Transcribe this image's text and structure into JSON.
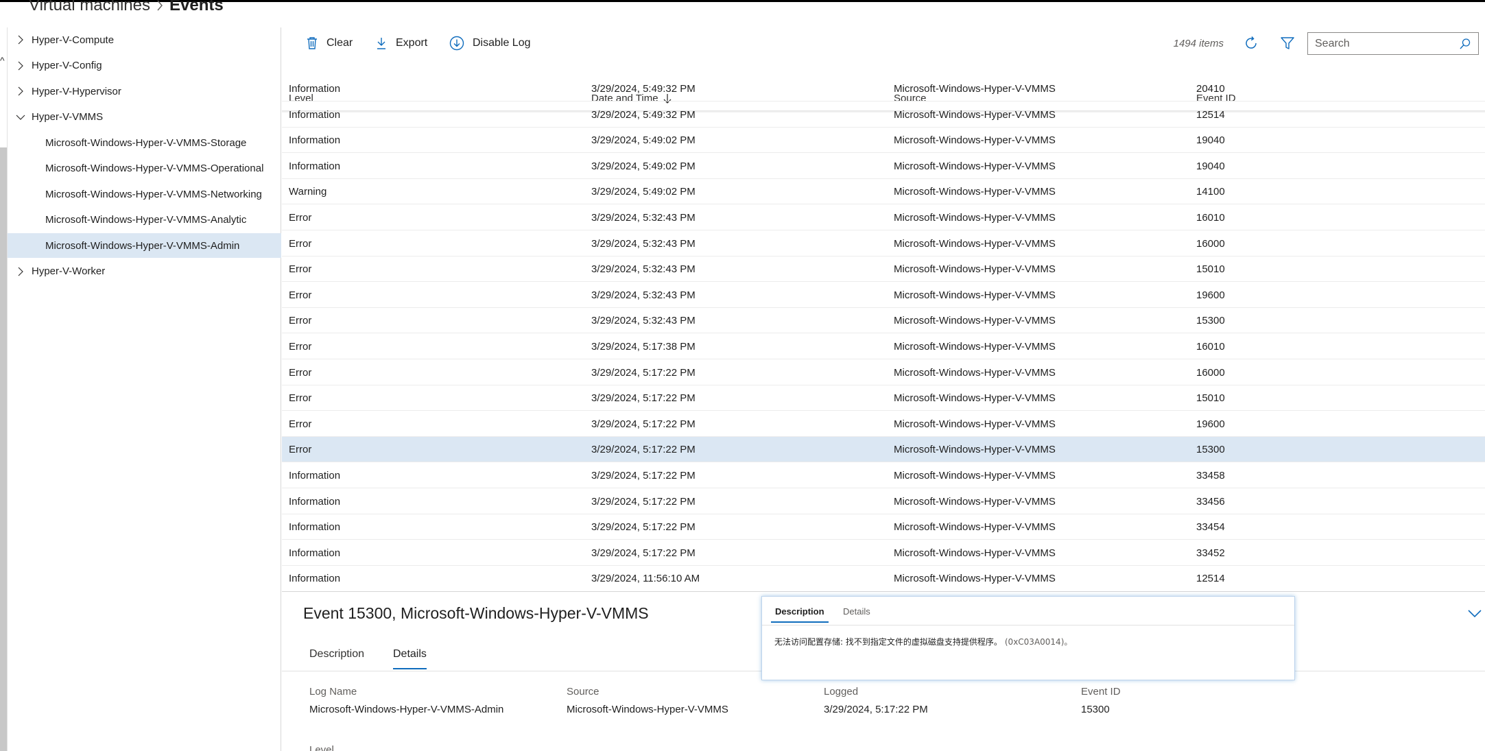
{
  "breadcrumb": {
    "parent": "Virtual machines",
    "current": "Events"
  },
  "sidebar": {
    "items": [
      {
        "label": "Hyper-V-Compute",
        "level": 0,
        "expanded": false
      },
      {
        "label": "Hyper-V-Config",
        "level": 0,
        "expanded": false
      },
      {
        "label": "Hyper-V-Hypervisor",
        "level": 0,
        "expanded": false
      },
      {
        "label": "Hyper-V-VMMS",
        "level": 0,
        "expanded": true
      },
      {
        "label": "Microsoft-Windows-Hyper-V-VMMS-Storage",
        "level": 1
      },
      {
        "label": "Microsoft-Windows-Hyper-V-VMMS-Operational",
        "level": 1
      },
      {
        "label": "Microsoft-Windows-Hyper-V-VMMS-Networking",
        "level": 1
      },
      {
        "label": "Microsoft-Windows-Hyper-V-VMMS-Analytic",
        "level": 1
      },
      {
        "label": "Microsoft-Windows-Hyper-V-VMMS-Admin",
        "level": 1,
        "selected": true
      },
      {
        "label": "Hyper-V-Worker",
        "level": 0,
        "expanded": false
      }
    ]
  },
  "toolbar": {
    "clear_label": "Clear",
    "export_label": "Export",
    "disable_log_label": "Disable Log",
    "item_count": "1494 items",
    "search_placeholder": "Search",
    "accent_color": "#0f6cbd"
  },
  "grid": {
    "columns": {
      "level": "Level",
      "date_time": "Date and Time",
      "source": "Source",
      "event_id": "Event ID"
    },
    "sort": {
      "column": "date_time",
      "direction": "descending"
    },
    "rows": [
      {
        "level": "Information",
        "date": "3/29/2024, 5:49:32 PM",
        "source": "Microsoft-Windows-Hyper-V-VMMS",
        "event_id": "20410"
      },
      {
        "level": "Information",
        "date": "3/29/2024, 5:49:32 PM",
        "source": "Microsoft-Windows-Hyper-V-VMMS",
        "event_id": "12514"
      },
      {
        "level": "Information",
        "date": "3/29/2024, 5:49:02 PM",
        "source": "Microsoft-Windows-Hyper-V-VMMS",
        "event_id": "19040"
      },
      {
        "level": "Information",
        "date": "3/29/2024, 5:49:02 PM",
        "source": "Microsoft-Windows-Hyper-V-VMMS",
        "event_id": "19040"
      },
      {
        "level": "Warning",
        "date": "3/29/2024, 5:49:02 PM",
        "source": "Microsoft-Windows-Hyper-V-VMMS",
        "event_id": "14100"
      },
      {
        "level": "Error",
        "date": "3/29/2024, 5:32:43 PM",
        "source": "Microsoft-Windows-Hyper-V-VMMS",
        "event_id": "16010"
      },
      {
        "level": "Error",
        "date": "3/29/2024, 5:32:43 PM",
        "source": "Microsoft-Windows-Hyper-V-VMMS",
        "event_id": "16000"
      },
      {
        "level": "Error",
        "date": "3/29/2024, 5:32:43 PM",
        "source": "Microsoft-Windows-Hyper-V-VMMS",
        "event_id": "15010"
      },
      {
        "level": "Error",
        "date": "3/29/2024, 5:32:43 PM",
        "source": "Microsoft-Windows-Hyper-V-VMMS",
        "event_id": "19600"
      },
      {
        "level": "Error",
        "date": "3/29/2024, 5:32:43 PM",
        "source": "Microsoft-Windows-Hyper-V-VMMS",
        "event_id": "15300"
      },
      {
        "level": "Error",
        "date": "3/29/2024, 5:17:38 PM",
        "source": "Microsoft-Windows-Hyper-V-VMMS",
        "event_id": "16010"
      },
      {
        "level": "Error",
        "date": "3/29/2024, 5:17:22 PM",
        "source": "Microsoft-Windows-Hyper-V-VMMS",
        "event_id": "16000"
      },
      {
        "level": "Error",
        "date": "3/29/2024, 5:17:22 PM",
        "source": "Microsoft-Windows-Hyper-V-VMMS",
        "event_id": "15010"
      },
      {
        "level": "Error",
        "date": "3/29/2024, 5:17:22 PM",
        "source": "Microsoft-Windows-Hyper-V-VMMS",
        "event_id": "19600"
      },
      {
        "level": "Error",
        "date": "3/29/2024, 5:17:22 PM",
        "source": "Microsoft-Windows-Hyper-V-VMMS",
        "event_id": "15300",
        "selected": true
      },
      {
        "level": "Information",
        "date": "3/29/2024, 5:17:22 PM",
        "source": "Microsoft-Windows-Hyper-V-VMMS",
        "event_id": "33458"
      },
      {
        "level": "Information",
        "date": "3/29/2024, 5:17:22 PM",
        "source": "Microsoft-Windows-Hyper-V-VMMS",
        "event_id": "33456"
      },
      {
        "level": "Information",
        "date": "3/29/2024, 5:17:22 PM",
        "source": "Microsoft-Windows-Hyper-V-VMMS",
        "event_id": "33454"
      },
      {
        "level": "Information",
        "date": "3/29/2024, 5:17:22 PM",
        "source": "Microsoft-Windows-Hyper-V-VMMS",
        "event_id": "33452"
      },
      {
        "level": "Information",
        "date": "3/29/2024, 11:56:10 AM",
        "source": "Microsoft-Windows-Hyper-V-VMMS",
        "event_id": "12514"
      }
    ]
  },
  "detail": {
    "title": "Event 15300, Microsoft-Windows-Hyper-V-VMMS",
    "tabs": {
      "description": "Description",
      "details": "Details"
    },
    "active_tab": "details",
    "fields": {
      "log_name_label": "Log Name",
      "log_name_value": "Microsoft-Windows-Hyper-V-VMMS-Admin",
      "source_label": "Source",
      "source_value": "Microsoft-Windows-Hyper-V-VMMS",
      "logged_label": "Logged",
      "logged_value": "3/29/2024, 5:17:22 PM",
      "event_id_label": "Event ID",
      "event_id_value": "15300",
      "level_label": "Level"
    }
  },
  "popup": {
    "tabs": {
      "description": "Description",
      "details": "Details"
    },
    "active_tab": "description",
    "message": "无法访问配置存储: 找不到指定文件的虚拟磁盘支持提供程序。",
    "code": "(0xC03A0014)。"
  }
}
